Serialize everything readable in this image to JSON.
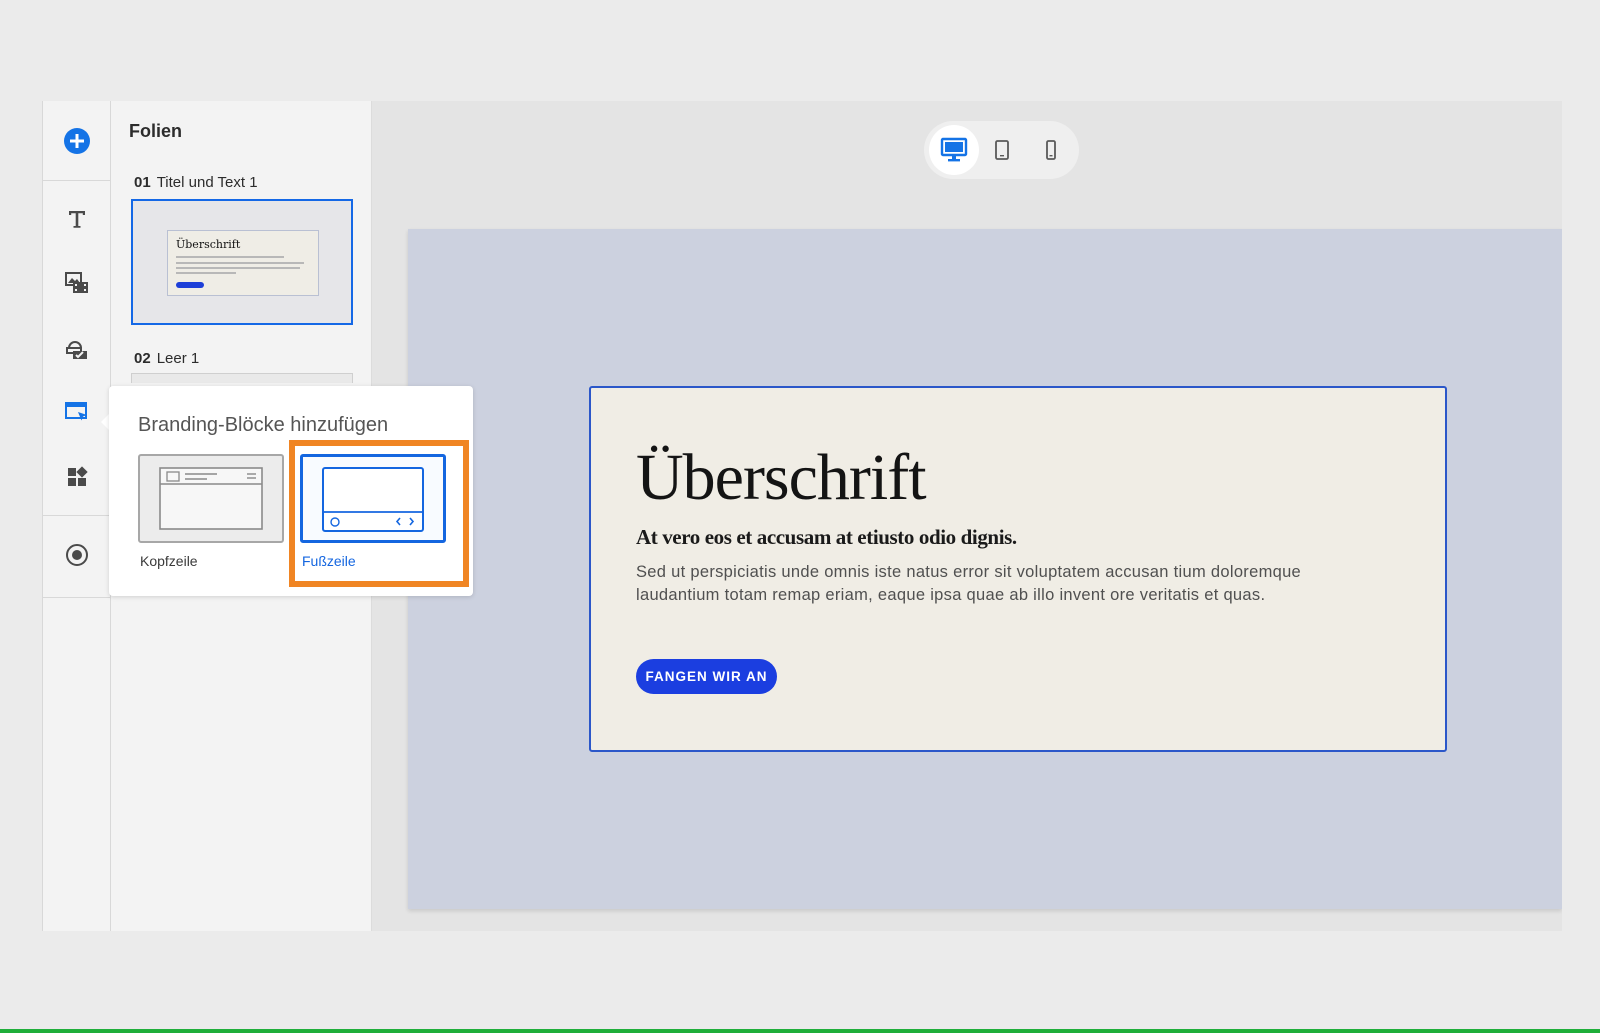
{
  "slides_panel": {
    "title": "Folien",
    "slides": [
      {
        "number": "01",
        "name": "Titel und Text 1",
        "thumb_heading": "Überschrift"
      },
      {
        "number": "02",
        "name": "Leer 1"
      }
    ]
  },
  "rail": {
    "icons": [
      "add-icon",
      "text-icon",
      "media-icon",
      "interaction-icon",
      "branding-icon",
      "widgets-icon",
      "record-icon"
    ]
  },
  "device_switch": {
    "options": [
      "desktop-icon",
      "tablet-icon",
      "mobile-icon"
    ],
    "active": "desktop"
  },
  "slide_content": {
    "heading": "Überschrift",
    "subheading": "At vero eos et accusam at etiusto odio dignis.",
    "body": "Sed ut perspiciatis unde omnis iste natus error sit voluptatem accusan tium doloremque laudantium totam remap eriam, eaque ipsa quae ab illo invent ore veritatis et quas.",
    "cta": "FANGEN WIR AN"
  },
  "branding_popover": {
    "title": "Branding-Blöcke hinzufügen",
    "options": [
      {
        "label": "Kopfzeile",
        "selected": false
      },
      {
        "label": "Fußzeile",
        "selected": true
      }
    ]
  },
  "colors": {
    "accent_blue": "#1466e0",
    "cta_blue": "#1b3ee0",
    "highlight_orange": "#f08523",
    "stage_bg": "#ccd1df",
    "card_bg": "#f0ede5"
  }
}
